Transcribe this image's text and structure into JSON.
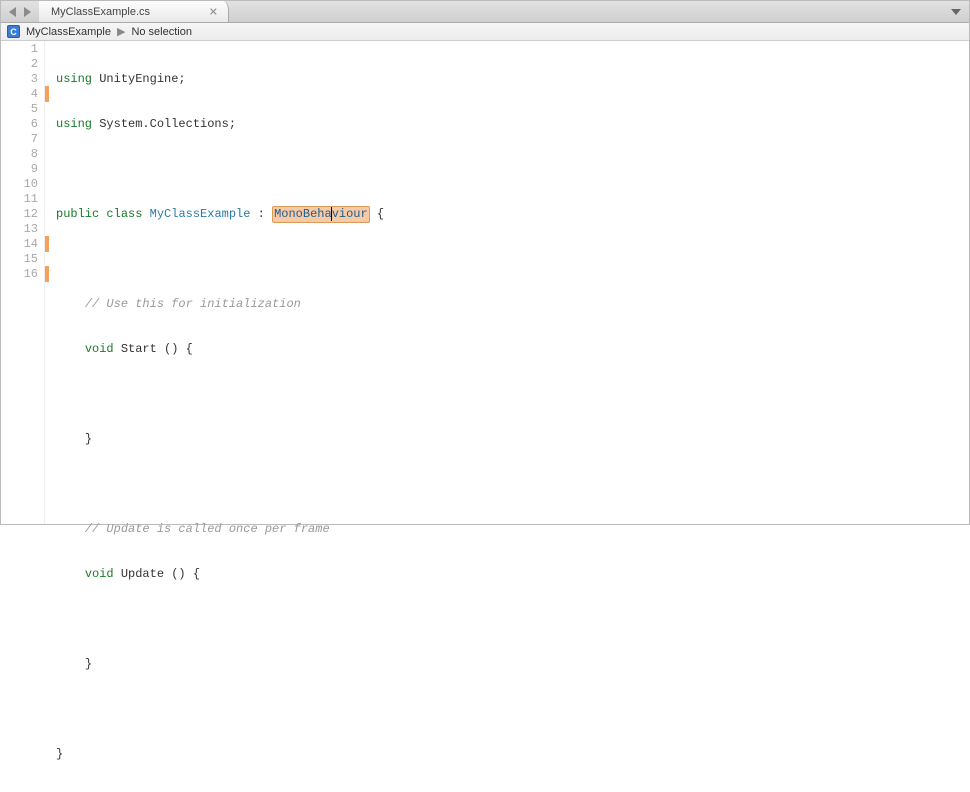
{
  "tabbar": {
    "tab_label": "MyClassExample.cs"
  },
  "navbar": {
    "badge_letter": "C",
    "crumb1": "MyClassExample",
    "crumb_sep": "▶",
    "crumb2": "No selection"
  },
  "gutter": {
    "lines": [
      "1",
      "2",
      "3",
      "4",
      "5",
      "6",
      "7",
      "8",
      "9",
      "10",
      "11",
      "12",
      "13",
      "14",
      "15",
      "16"
    ]
  },
  "code": {
    "l1": {
      "kw": "using",
      "txt": " UnityEngine;"
    },
    "l2": {
      "kw": "using",
      "txt": " System.Collections;"
    },
    "l3": "",
    "l4": {
      "kw1": "public",
      "kw2": "class",
      "name": "MyClassExample",
      "colon": " : ",
      "base": "MonoBehaviour",
      "brace": " {"
    },
    "l5": "",
    "l6": {
      "c": "// Use this for initialization"
    },
    "l7": {
      "kw": "void",
      "name": " Start () {"
    },
    "l8": "",
    "l9": {
      "txt": "}"
    },
    "l10": "",
    "l11": {
      "c": "// Update is called once per frame"
    },
    "l12": {
      "kw": "void",
      "name": " Update () {"
    },
    "l13": "",
    "l14": {
      "txt": "}"
    },
    "l15": "",
    "l16": {
      "txt": "}"
    }
  }
}
